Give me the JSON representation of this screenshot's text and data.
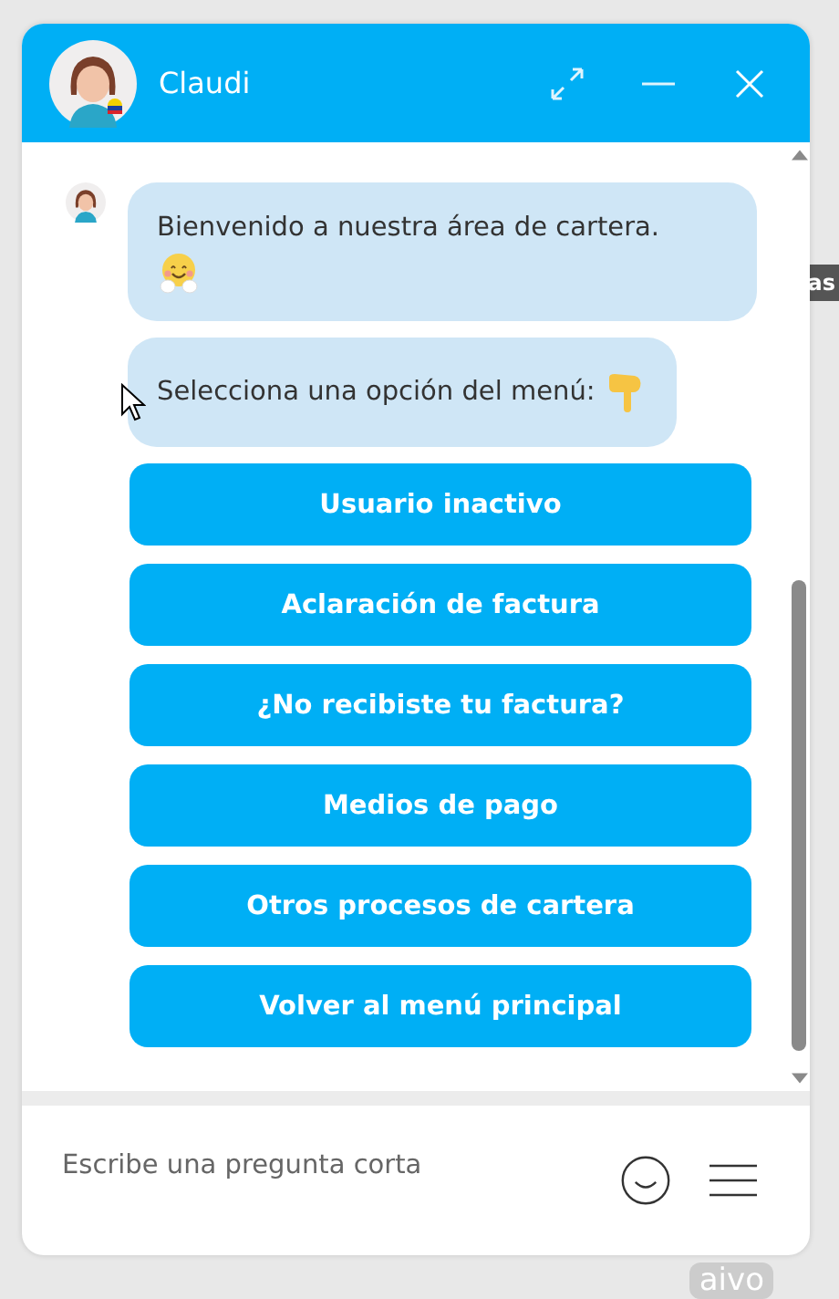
{
  "background": {
    "text_fragment": "as"
  },
  "header": {
    "agent_name": "Claudi"
  },
  "messages": [
    {
      "text": "Bienvenido a nuestra área de cartera.",
      "kind": "hugging"
    },
    {
      "text": "Selecciona una opción del menú:",
      "kind": "pointing"
    }
  ],
  "options": [
    "Usuario inactivo",
    "Aclaración de factura",
    "¿No recibiste tu factura?",
    "Medios de pago",
    "Otros procesos de cartera",
    "Volver al menú principal"
  ],
  "composer": {
    "placeholder": "Escribe una pregunta corta"
  },
  "branding": "aivo"
}
